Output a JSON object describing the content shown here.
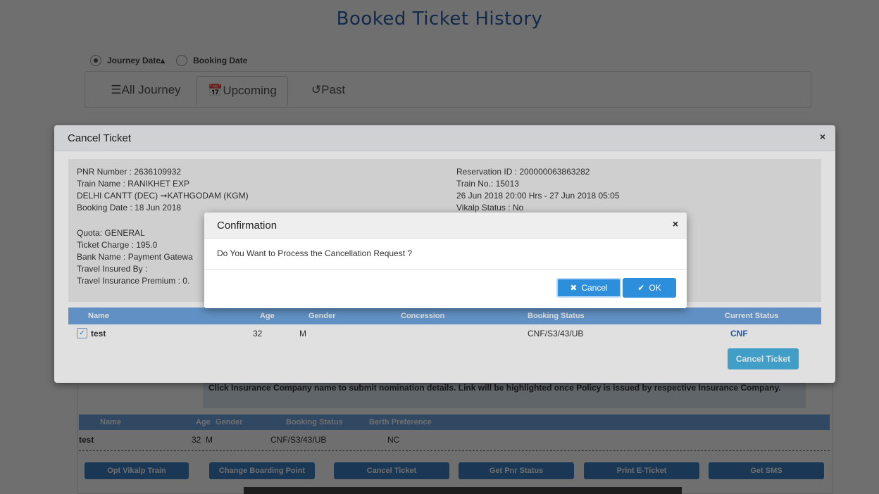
{
  "page": {
    "title": "Booked Ticket History",
    "radio_journey": "Journey Date▴",
    "radio_booking": "Booking Date",
    "tabs": [
      {
        "icon": "list-icon",
        "label": "All Journey"
      },
      {
        "icon": "calendar-icon",
        "label": "Upcoming"
      },
      {
        "icon": "history-icon",
        "label": "Past"
      }
    ],
    "insurance_note": "Click Insurance Company name to submit nomination details. Link will be highlighted once Policy is issued by respective Insurance Company.",
    "mini_headers": [
      "Name",
      "Age",
      "Gender",
      "Booking Status",
      "Berth Preference"
    ],
    "mini_row": {
      "name": "test",
      "age": "32",
      "gender": "M",
      "booking_status": "CNF/S3/43/UB",
      "berth": "NC"
    },
    "action_buttons": [
      "Opt Vikalp Train",
      "Change Boarding Point",
      "Cancel Ticket",
      "Get Pnr Status",
      "Print E-Ticket",
      "Get SMS"
    ]
  },
  "cancel_modal": {
    "title": "Cancel Ticket",
    "close": "×",
    "left_lines": [
      "PNR Number : 2636109932",
      "Train Name : RANIKHET EXP",
      "DELHI CANTT (DEC) ➞KATHGODAM (KGM)",
      "Booking Date : 18 Jun 2018",
      "",
      "Quota: GENERAL",
      "Ticket Charge : 195.0",
      "Bank Name : Payment Gatewa",
      "Travel Insured By :",
      "Travel Insurance Premium : 0."
    ],
    "right_lines": [
      "Reservation ID : 200000063863282",
      "Train No.: 15013",
      "26 Jun 2018 20:00 Hrs - 27 Jun 2018 05:05",
      "Vikalp Status : No"
    ],
    "table_headers": [
      "Name",
      "Age",
      "Gender",
      "Concession",
      "Booking Status",
      "Current Status"
    ],
    "passenger": {
      "name": "test",
      "age": "32",
      "gender": "M",
      "concession": "",
      "booking_status": "CNF/S3/43/UB",
      "current_status": "CNF"
    },
    "cancel_button": "Cancel Ticket"
  },
  "confirm_dialog": {
    "title": "Confirmation",
    "close": "×",
    "message": "Do You Want to Process the Cancellation Request ?",
    "cancel_label": "Cancel",
    "ok_label": "OK"
  }
}
